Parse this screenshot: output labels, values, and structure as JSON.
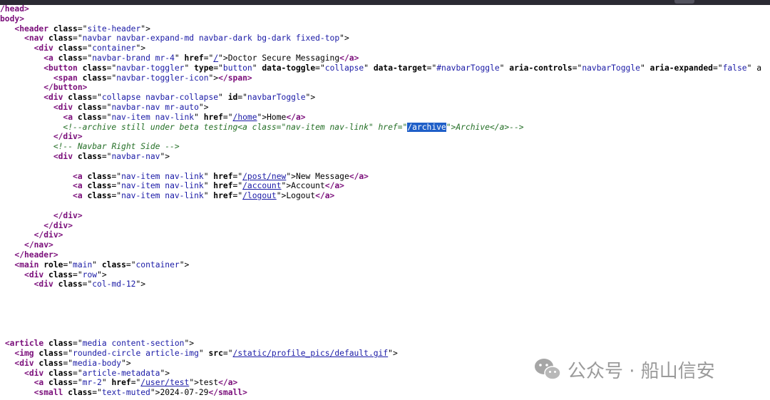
{
  "lines": [
    [
      [
        "tag",
        "/head>"
      ]
    ],
    [
      [
        "tag",
        "body>"
      ]
    ],
    [
      [
        "txt",
        "   "
      ],
      [
        "tag",
        "<header "
      ],
      [
        "attr",
        "class"
      ],
      [
        "txt",
        "=\""
      ],
      [
        "val",
        "site-header"
      ],
      [
        "txt",
        "\">"
      ]
    ],
    [
      [
        "txt",
        "     "
      ],
      [
        "tag",
        "<nav "
      ],
      [
        "attr",
        "class"
      ],
      [
        "txt",
        "=\""
      ],
      [
        "val",
        "navbar navbar-expand-md navbar-dark bg-dark fixed-top"
      ],
      [
        "txt",
        "\">"
      ]
    ],
    [
      [
        "txt",
        "       "
      ],
      [
        "tag",
        "<div "
      ],
      [
        "attr",
        "class"
      ],
      [
        "txt",
        "=\""
      ],
      [
        "val",
        "container"
      ],
      [
        "txt",
        "\">"
      ]
    ],
    [
      [
        "txt",
        "         "
      ],
      [
        "tag",
        "<a "
      ],
      [
        "attr",
        "class"
      ],
      [
        "txt",
        "=\""
      ],
      [
        "val",
        "navbar-brand mr-4"
      ],
      [
        "txt",
        "\" "
      ],
      [
        "attr",
        "href"
      ],
      [
        "txt",
        "=\""
      ],
      [
        "lnk",
        "/"
      ],
      [
        "txt",
        "\">Doctor Secure Messaging"
      ],
      [
        "tag",
        "</a>"
      ]
    ],
    [
      [
        "txt",
        "         "
      ],
      [
        "tag",
        "<button "
      ],
      [
        "attr",
        "class"
      ],
      [
        "txt",
        "=\""
      ],
      [
        "val",
        "navbar-toggler"
      ],
      [
        "txt",
        "\" "
      ],
      [
        "attr",
        "type"
      ],
      [
        "txt",
        "=\""
      ],
      [
        "val",
        "button"
      ],
      [
        "txt",
        "\" "
      ],
      [
        "attr",
        "data-toggle"
      ],
      [
        "txt",
        "=\""
      ],
      [
        "val",
        "collapse"
      ],
      [
        "txt",
        "\" "
      ],
      [
        "attr",
        "data-target"
      ],
      [
        "txt",
        "=\""
      ],
      [
        "val",
        "#navbarToggle"
      ],
      [
        "txt",
        "\" "
      ],
      [
        "attr",
        "aria-controls"
      ],
      [
        "txt",
        "=\""
      ],
      [
        "val",
        "navbarToggle"
      ],
      [
        "txt",
        "\" "
      ],
      [
        "attr",
        "aria-expanded"
      ],
      [
        "txt",
        "=\""
      ],
      [
        "val",
        "false"
      ],
      [
        "txt",
        "\" a"
      ]
    ],
    [
      [
        "txt",
        "           "
      ],
      [
        "tag",
        "<span "
      ],
      [
        "attr",
        "class"
      ],
      [
        "txt",
        "=\""
      ],
      [
        "val",
        "navbar-toggler-icon"
      ],
      [
        "txt",
        "\">"
      ],
      [
        "tag",
        "</span>"
      ]
    ],
    [
      [
        "txt",
        "         "
      ],
      [
        "tag",
        "</button>"
      ]
    ],
    [
      [
        "txt",
        "         "
      ],
      [
        "tag",
        "<div "
      ],
      [
        "attr",
        "class"
      ],
      [
        "txt",
        "=\""
      ],
      [
        "val",
        "collapse navbar-collapse"
      ],
      [
        "txt",
        "\" "
      ],
      [
        "attr",
        "id"
      ],
      [
        "txt",
        "=\""
      ],
      [
        "val",
        "navbarToggle"
      ],
      [
        "txt",
        "\">"
      ]
    ],
    [
      [
        "txt",
        "           "
      ],
      [
        "tag",
        "<div "
      ],
      [
        "attr",
        "class"
      ],
      [
        "txt",
        "=\""
      ],
      [
        "val",
        "navbar-nav mr-auto"
      ],
      [
        "txt",
        "\">"
      ]
    ],
    [
      [
        "txt",
        "             "
      ],
      [
        "tag",
        "<a "
      ],
      [
        "attr",
        "class"
      ],
      [
        "txt",
        "=\""
      ],
      [
        "val",
        "nav-item nav-link"
      ],
      [
        "txt",
        "\" "
      ],
      [
        "attr",
        "href"
      ],
      [
        "txt",
        "=\""
      ],
      [
        "lnk",
        "/home"
      ],
      [
        "txt",
        "\">Home"
      ],
      [
        "tag",
        "</a>"
      ]
    ],
    [
      [
        "txt",
        "             "
      ],
      [
        "cmt",
        "<!--archive still under beta testing<a class=\"nav-item nav-link\" href=\""
      ],
      [
        "sel",
        "/archive"
      ],
      [
        "cmt",
        "\">Archive</a>-->"
      ]
    ],
    [
      [
        "txt",
        "           "
      ],
      [
        "tag",
        "</div>"
      ]
    ],
    [
      [
        "txt",
        "           "
      ],
      [
        "cmt",
        "<!-- Navbar Right Side -->"
      ]
    ],
    [
      [
        "txt",
        "           "
      ],
      [
        "tag",
        "<div "
      ],
      [
        "attr",
        "class"
      ],
      [
        "txt",
        "=\""
      ],
      [
        "val",
        "navbar-nav"
      ],
      [
        "txt",
        "\">"
      ]
    ],
    [
      [
        "txt",
        ""
      ]
    ],
    [
      [
        "txt",
        "               "
      ],
      [
        "tag",
        "<a "
      ],
      [
        "attr",
        "class"
      ],
      [
        "txt",
        "=\""
      ],
      [
        "val",
        "nav-item nav-link"
      ],
      [
        "txt",
        "\" "
      ],
      [
        "attr",
        "href"
      ],
      [
        "txt",
        "=\""
      ],
      [
        "lnk",
        "/post/new"
      ],
      [
        "txt",
        "\">New Message"
      ],
      [
        "tag",
        "</a>"
      ]
    ],
    [
      [
        "txt",
        "               "
      ],
      [
        "tag",
        "<a "
      ],
      [
        "attr",
        "class"
      ],
      [
        "txt",
        "=\""
      ],
      [
        "val",
        "nav-item nav-link"
      ],
      [
        "txt",
        "\" "
      ],
      [
        "attr",
        "href"
      ],
      [
        "txt",
        "=\""
      ],
      [
        "lnk",
        "/account"
      ],
      [
        "txt",
        "\">Account"
      ],
      [
        "tag",
        "</a>"
      ]
    ],
    [
      [
        "txt",
        "               "
      ],
      [
        "tag",
        "<a "
      ],
      [
        "attr",
        "class"
      ],
      [
        "txt",
        "=\""
      ],
      [
        "val",
        "nav-item nav-link"
      ],
      [
        "txt",
        "\" "
      ],
      [
        "attr",
        "href"
      ],
      [
        "txt",
        "=\""
      ],
      [
        "lnk",
        "/logout"
      ],
      [
        "txt",
        "\">Logout"
      ],
      [
        "tag",
        "</a>"
      ]
    ],
    [
      [
        "txt",
        ""
      ]
    ],
    [
      [
        "txt",
        "           "
      ],
      [
        "tag",
        "</div>"
      ]
    ],
    [
      [
        "txt",
        "         "
      ],
      [
        "tag",
        "</div>"
      ]
    ],
    [
      [
        "txt",
        "       "
      ],
      [
        "tag",
        "</div>"
      ]
    ],
    [
      [
        "txt",
        "     "
      ],
      [
        "tag",
        "</nav>"
      ]
    ],
    [
      [
        "txt",
        "   "
      ],
      [
        "tag",
        "</header>"
      ]
    ],
    [
      [
        "txt",
        "   "
      ],
      [
        "tag",
        "<main "
      ],
      [
        "attr",
        "role"
      ],
      [
        "txt",
        "=\""
      ],
      [
        "val",
        "main"
      ],
      [
        "txt",
        "\" "
      ],
      [
        "attr",
        "class"
      ],
      [
        "txt",
        "=\""
      ],
      [
        "val",
        "container"
      ],
      [
        "txt",
        "\">"
      ]
    ],
    [
      [
        "txt",
        "     "
      ],
      [
        "tag",
        "<div "
      ],
      [
        "attr",
        "class"
      ],
      [
        "txt",
        "=\""
      ],
      [
        "val",
        "row"
      ],
      [
        "txt",
        "\">"
      ]
    ],
    [
      [
        "txt",
        "       "
      ],
      [
        "tag",
        "<div "
      ],
      [
        "attr",
        "class"
      ],
      [
        "txt",
        "=\""
      ],
      [
        "val",
        "col-md-12"
      ],
      [
        "txt",
        "\">"
      ]
    ],
    [
      [
        "txt",
        ""
      ]
    ],
    [
      [
        "txt",
        ""
      ]
    ],
    [
      [
        "txt",
        ""
      ]
    ],
    [
      [
        "txt",
        ""
      ]
    ],
    [
      [
        "txt",
        ""
      ]
    ],
    [
      [
        "txt",
        " "
      ],
      [
        "tag",
        "<article "
      ],
      [
        "attr",
        "class"
      ],
      [
        "txt",
        "=\""
      ],
      [
        "val",
        "media content-section"
      ],
      [
        "txt",
        "\">"
      ]
    ],
    [
      [
        "txt",
        "   "
      ],
      [
        "tag",
        "<img "
      ],
      [
        "attr",
        "class"
      ],
      [
        "txt",
        "=\""
      ],
      [
        "val",
        "rounded-circle article-img"
      ],
      [
        "txt",
        "\" "
      ],
      [
        "attr",
        "src"
      ],
      [
        "txt",
        "=\""
      ],
      [
        "lnk",
        "/static/profile_pics/default.gif"
      ],
      [
        "txt",
        "\">"
      ]
    ],
    [
      [
        "txt",
        "   "
      ],
      [
        "tag",
        "<div "
      ],
      [
        "attr",
        "class"
      ],
      [
        "txt",
        "=\""
      ],
      [
        "val",
        "media-body"
      ],
      [
        "txt",
        "\">"
      ]
    ],
    [
      [
        "txt",
        "     "
      ],
      [
        "tag",
        "<div "
      ],
      [
        "attr",
        "class"
      ],
      [
        "txt",
        "=\""
      ],
      [
        "val",
        "article-metadata"
      ],
      [
        "txt",
        "\">"
      ]
    ],
    [
      [
        "txt",
        "       "
      ],
      [
        "tag",
        "<a "
      ],
      [
        "attr",
        "class"
      ],
      [
        "txt",
        "=\""
      ],
      [
        "val",
        "mr-2"
      ],
      [
        "txt",
        "\" "
      ],
      [
        "attr",
        "href"
      ],
      [
        "txt",
        "=\""
      ],
      [
        "lnk",
        "/user/test"
      ],
      [
        "txt",
        "\">test"
      ],
      [
        "tag",
        "</a>"
      ]
    ],
    [
      [
        "txt",
        "       "
      ],
      [
        "tag",
        "<small "
      ],
      [
        "attr",
        "class"
      ],
      [
        "txt",
        "=\""
      ],
      [
        "val",
        "text-muted"
      ],
      [
        "txt",
        "\">2024-07-29"
      ],
      [
        "tag",
        "</small>"
      ]
    ]
  ],
  "watermark": {
    "text": "公众号 · 船山信安",
    "icon": "wechat-icon"
  },
  "colors": {
    "tag": "#7a0d7a",
    "value": "#1a1aa6",
    "comment": "#236e25",
    "selection": "#1f5fc8"
  }
}
